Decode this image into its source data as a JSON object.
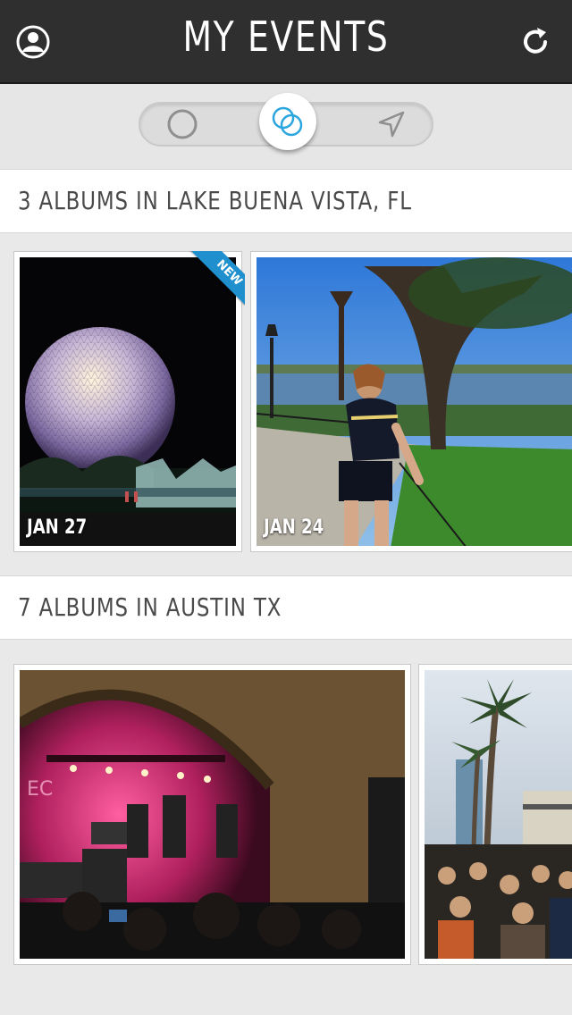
{
  "header": {
    "title": "MY EVENTS",
    "profile_icon": "profile-icon",
    "refresh_icon": "refresh-icon"
  },
  "toggle": {
    "options": [
      {
        "icon": "circle-icon"
      },
      {
        "icon": "overlapping-circles-icon",
        "selected": true
      },
      {
        "icon": "location-arrow-icon"
      }
    ],
    "accent": "#2ba6de"
  },
  "sections": [
    {
      "title": "3 ALBUMS IN LAKE BUENA VISTA, FL",
      "albums": [
        {
          "date": "JAN 27",
          "badge": "NEW",
          "scene": "night-geodesic-sphere"
        },
        {
          "date": "JAN 24",
          "scene": "waterfront-park"
        }
      ]
    },
    {
      "title": "7 ALBUMS IN AUSTIN TX",
      "albums": [
        {
          "scene": "concert-stage"
        },
        {
          "scene": "palm-tree-crowd"
        }
      ]
    }
  ],
  "colors": {
    "header_bg": "#2f2f2f",
    "page_bg": "#e9e9e9",
    "badge": "#1f8fcd"
  }
}
